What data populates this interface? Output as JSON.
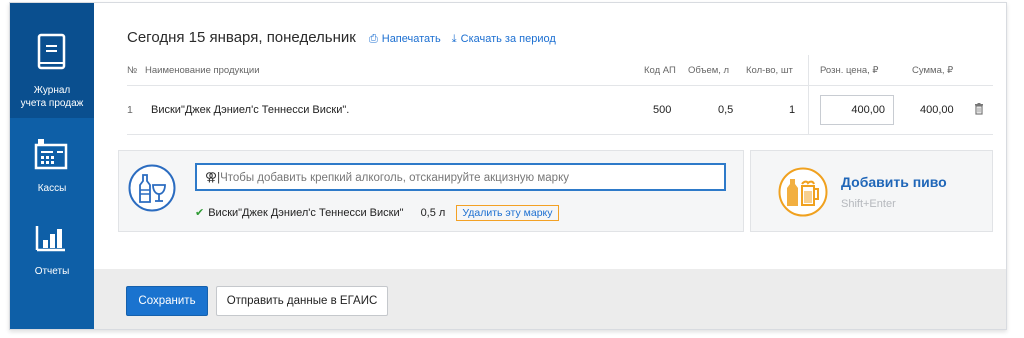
{
  "sidebar": {
    "items": [
      {
        "label_line1": "Журнал",
        "label_line2": "учета продаж",
        "icon": "journal-icon",
        "active": true
      },
      {
        "label": "Кассы",
        "icon": "cashbox-icon",
        "active": false
      },
      {
        "label": "Отчеты",
        "icon": "bar-chart-icon",
        "active": false
      }
    ]
  },
  "header": {
    "title": "Сегодня 15 января, понедельник",
    "print_label": "Напечатать",
    "print_icon": "printer-icon",
    "download_label": "Скачать за период",
    "download_icon": "download-icon"
  },
  "table": {
    "columns": [
      "№",
      "Наименование продукции",
      "Код АП",
      "Объем, л",
      "Кол-во, шт",
      "Розн. цена, ₽",
      "Сумма, ₽"
    ],
    "rows": [
      {
        "num": "1",
        "name": "Виски\"Джек Дэниел'с Теннесси Виски\".",
        "code": "500",
        "volume": "0,5",
        "qty": "1",
        "price": "400,00",
        "sum": "400,00"
      }
    ]
  },
  "scan_panel": {
    "placeholder": "Чтобы добавить крепкий алкоголь, отсканируйте акцизную марку",
    "scanned_item_name": "Виски\"Джек Дэниел'с Теннесси Виски\"",
    "scanned_item_volume": "0,5 л",
    "delete_mark_label": "Удалить эту марку"
  },
  "beer_panel": {
    "title": "Добавить пиво",
    "shortcut": "Shift+Enter"
  },
  "footer": {
    "save_label": "Сохранить",
    "send_label": "Отправить данные в ЕГАИС"
  },
  "colors": {
    "sidebar_bg": "#0e5fa7",
    "sidebar_active": "#0a4f8f",
    "primary_button": "#1a73cf",
    "link": "#1c6fd1",
    "scan_icon_blue": "#2b6cc0",
    "beer_icon_orange": "#f0a11f",
    "focus_orange": "#f3a125",
    "check_green": "#2f9b34"
  }
}
